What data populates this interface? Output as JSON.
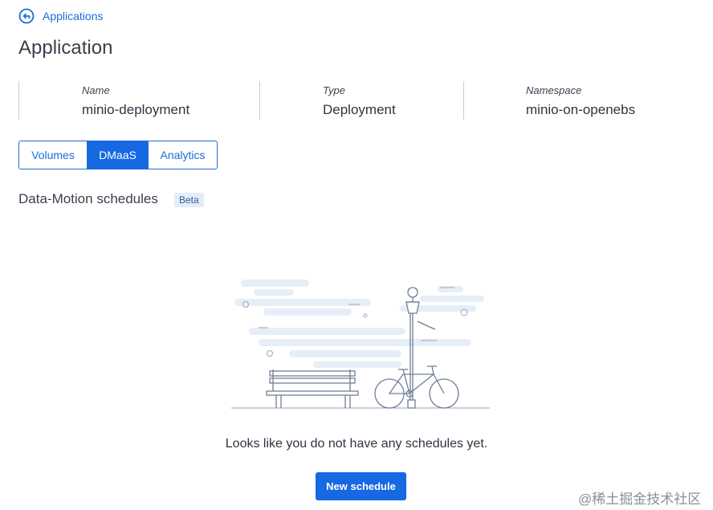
{
  "breadcrumb": {
    "back_label": "Applications"
  },
  "page": {
    "title": "Application"
  },
  "info": [
    {
      "label": "Name",
      "value": "minio-deployment"
    },
    {
      "label": "Type",
      "value": "Deployment"
    },
    {
      "label": "Namespace",
      "value": "minio-on-openebs"
    }
  ],
  "tabs": [
    {
      "label": "Volumes",
      "active": false
    },
    {
      "label": "DMaaS",
      "active": true
    },
    {
      "label": "Analytics",
      "active": false
    }
  ],
  "section": {
    "title": "Data-Motion schedules",
    "badge": "Beta"
  },
  "empty_state": {
    "illustration": "bench-bicycle-lamppost-illustration",
    "message": "Looks like you do not have any schedules yet.",
    "button_label": "New schedule"
  },
  "watermark": "@稀土掘金技术社区",
  "colors": {
    "primary": "#1668e3",
    "link": "#1a6ed8",
    "text": "#2f3440"
  }
}
